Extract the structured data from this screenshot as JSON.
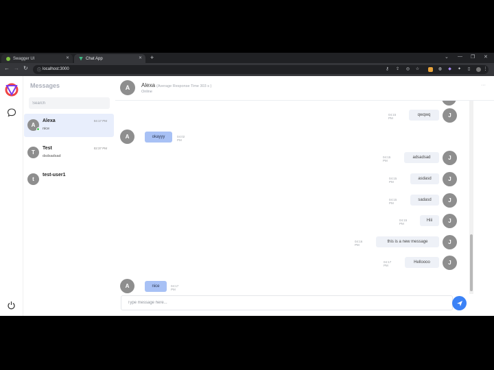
{
  "browser": {
    "tabs": [
      {
        "label": "Swagger UI",
        "active": false
      },
      {
        "label": "Chat App",
        "active": true
      }
    ],
    "url": "localhost:3000"
  },
  "sidebar": {
    "title": "Messages",
    "search_placeholder": "Search",
    "contacts": [
      {
        "initial": "A",
        "name": "Alexa",
        "preview": "nice",
        "time": "04:17 PM",
        "active": true,
        "online": true
      },
      {
        "initial": "T",
        "name": "Test",
        "preview": "dsdsadsad",
        "time": "02:37 PM",
        "active": false,
        "online": false
      },
      {
        "initial": "t",
        "name": "test-user1",
        "preview": "",
        "time": "",
        "active": false,
        "online": false
      }
    ]
  },
  "chat": {
    "header": {
      "initial": "A",
      "name": "Alexa",
      "response_time": "(Average Response Time 303 s )",
      "status": "Online",
      "menu_icon": "ellipsis-icon"
    },
    "messages": [
      {
        "direction": "out",
        "text": "qwqwq",
        "time": "04:15 PM",
        "initial": "J"
      },
      {
        "direction": "in",
        "text": "okayyy",
        "time": "04:02 PM",
        "initial": "A"
      },
      {
        "direction": "out",
        "text": "adsadsad",
        "time": "04:15 PM",
        "initial": "J"
      },
      {
        "direction": "out",
        "text": "asdasd",
        "time": "04:15 PM",
        "initial": "J"
      },
      {
        "direction": "out",
        "text": "sadasd",
        "time": "04:15 PM",
        "initial": "J"
      },
      {
        "direction": "out",
        "text": "Hiii",
        "time": "04:15 PM",
        "initial": "J"
      },
      {
        "direction": "out",
        "text": "this is a new message",
        "time": "04:16 PM",
        "initial": "J"
      },
      {
        "direction": "out",
        "text": "Helloooo",
        "time": "04:17 PM",
        "initial": "J"
      },
      {
        "direction": "in",
        "text": "nice",
        "time": "04:17 PM",
        "initial": "A"
      }
    ],
    "compose_placeholder": "Type message here...",
    "send_icon": "send-icon"
  },
  "colors": {
    "accent": "#3b82f6",
    "incoming_bubble": "#a8c1f5",
    "outgoing_bubble": "#eef1f7",
    "active_contact": "#e8eefc",
    "online": "#46c35a",
    "avatar": "#8e8e8e"
  }
}
